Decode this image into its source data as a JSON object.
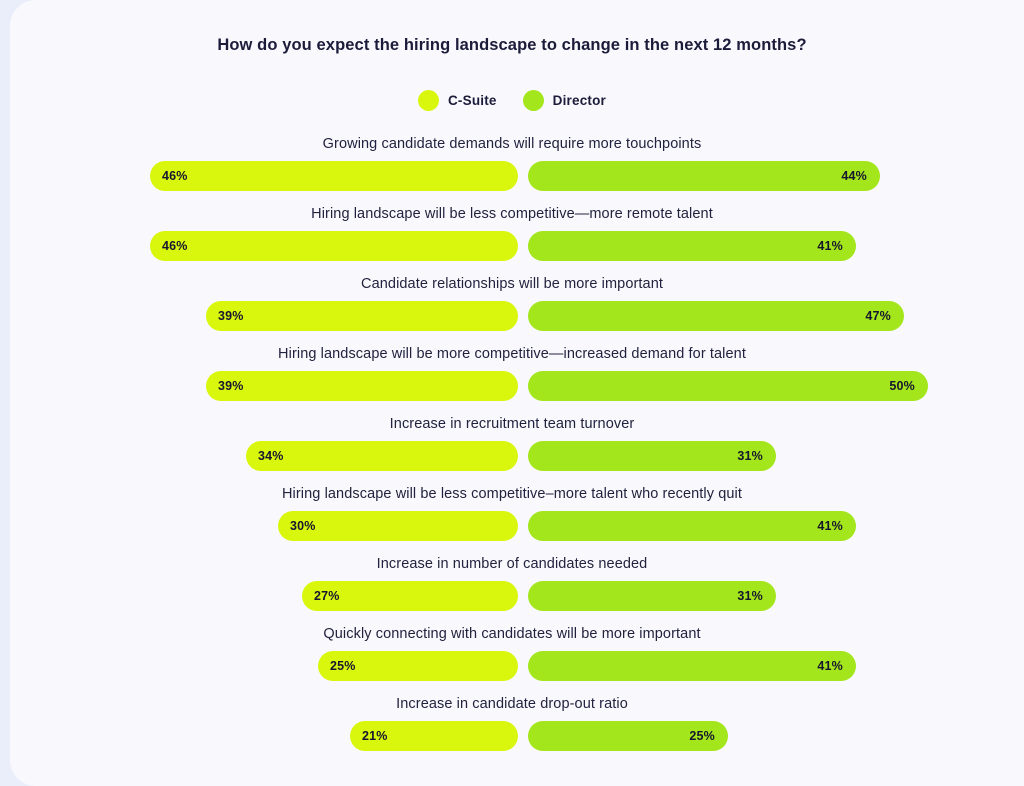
{
  "chart_data": {
    "type": "bar",
    "title": "How do you expect the hiring landscape to change in the next 12 months?",
    "xlabel": "",
    "ylabel": "",
    "orientation": "horizontal",
    "layout": "diverging-mirrored",
    "grid": false,
    "legend_position": "top-center",
    "xlim": [
      0,
      50
    ],
    "value_suffix": "%",
    "legend": [
      {
        "name": "C-Suite",
        "color": "#d9f70d"
      },
      {
        "name": "Director",
        "color": "#a3e61b"
      }
    ],
    "categories": [
      "Growing candidate demands will require more touchpoints",
      "Hiring landscape will be less competitive—more remote talent",
      "Candidate relationships will be more important",
      "Hiring landscape will be more competitive—increased demand for talent",
      "Increase in recruitment team turnover",
      "Hiring landscape will be less competitive–more talent who recently quit",
      "Increase in number of candidates needed",
      "Quickly connecting with candidates will be more important",
      "Increase in candidate drop-out ratio"
    ],
    "series": [
      {
        "name": "C-Suite",
        "color": "#d9f70d",
        "values": [
          46,
          46,
          39,
          39,
          34,
          30,
          27,
          25,
          21
        ],
        "labels": [
          "46%",
          "46%",
          "39%",
          "39%",
          "34%",
          "30%",
          "27%",
          "25%",
          "21%"
        ]
      },
      {
        "name": "Director",
        "color": "#a3e61b",
        "values": [
          44,
          41,
          47,
          50,
          31,
          41,
          31,
          41,
          25
        ],
        "labels": [
          "44%",
          "41%",
          "47%",
          "50%",
          "31%",
          "41%",
          "31%",
          "41%",
          "25%"
        ]
      }
    ]
  }
}
